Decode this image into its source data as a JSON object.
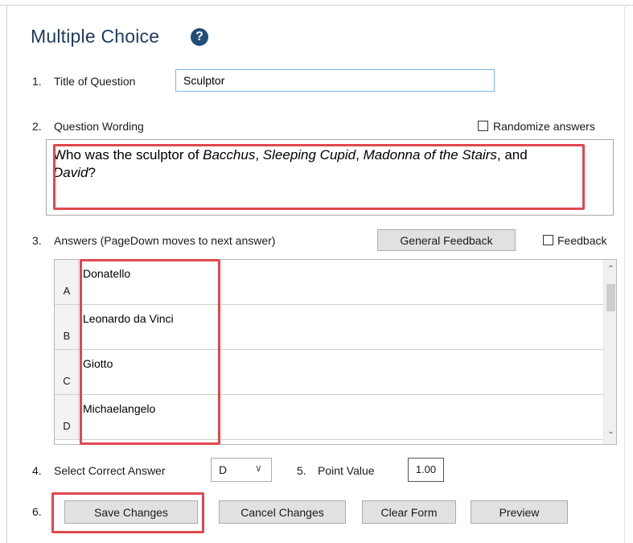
{
  "header": {
    "title": "Multiple Choice",
    "help_icon": "?"
  },
  "fields": {
    "title_of_question": {
      "number": "1.",
      "label": "Title of Question",
      "value": "Sculptor"
    },
    "question_wording": {
      "number": "2.",
      "label": "Question Wording",
      "randomize_label": "Randomize answers",
      "randomize_checked": false,
      "text_parts": [
        {
          "text": "Who was the sculptor of ",
          "italic": false
        },
        {
          "text": "Bacchus",
          "italic": true
        },
        {
          "text": ", ",
          "italic": false
        },
        {
          "text": "Sleeping Cupid",
          "italic": true
        },
        {
          "text": ", ",
          "italic": false
        },
        {
          "text": "Madonna of the Stairs",
          "italic": true
        },
        {
          "text": ", and ",
          "italic": false
        },
        {
          "text": "David",
          "italic": true
        },
        {
          "text": "?",
          "italic": false
        }
      ]
    },
    "answers": {
      "number": "3.",
      "label": "Answers  (PageDown moves to next answer)",
      "general_feedback_button": "General Feedback",
      "feedback_label": "Feedback",
      "feedback_checked": false,
      "rows": [
        {
          "letter": "A",
          "text": "Donatello"
        },
        {
          "letter": "B",
          "text": "Leonardo da Vinci"
        },
        {
          "letter": "C",
          "text": "Giotto"
        },
        {
          "letter": "D",
          "text": "Michaelangelo"
        }
      ]
    },
    "correct_answer": {
      "number": "4.",
      "label": "Select Correct Answer",
      "value": "D"
    },
    "point_value": {
      "number": "5.",
      "label": "Point Value",
      "value": "1.00"
    }
  },
  "actions": {
    "number": "6.",
    "save": "Save Changes",
    "cancel": "Cancel Changes",
    "clear": "Clear Form",
    "preview": "Preview"
  },
  "colors": {
    "title": "#1f3a5f",
    "highlight": "#e0484f",
    "input_border": "#7eb4ea",
    "help_icon": "#1f4e79"
  }
}
